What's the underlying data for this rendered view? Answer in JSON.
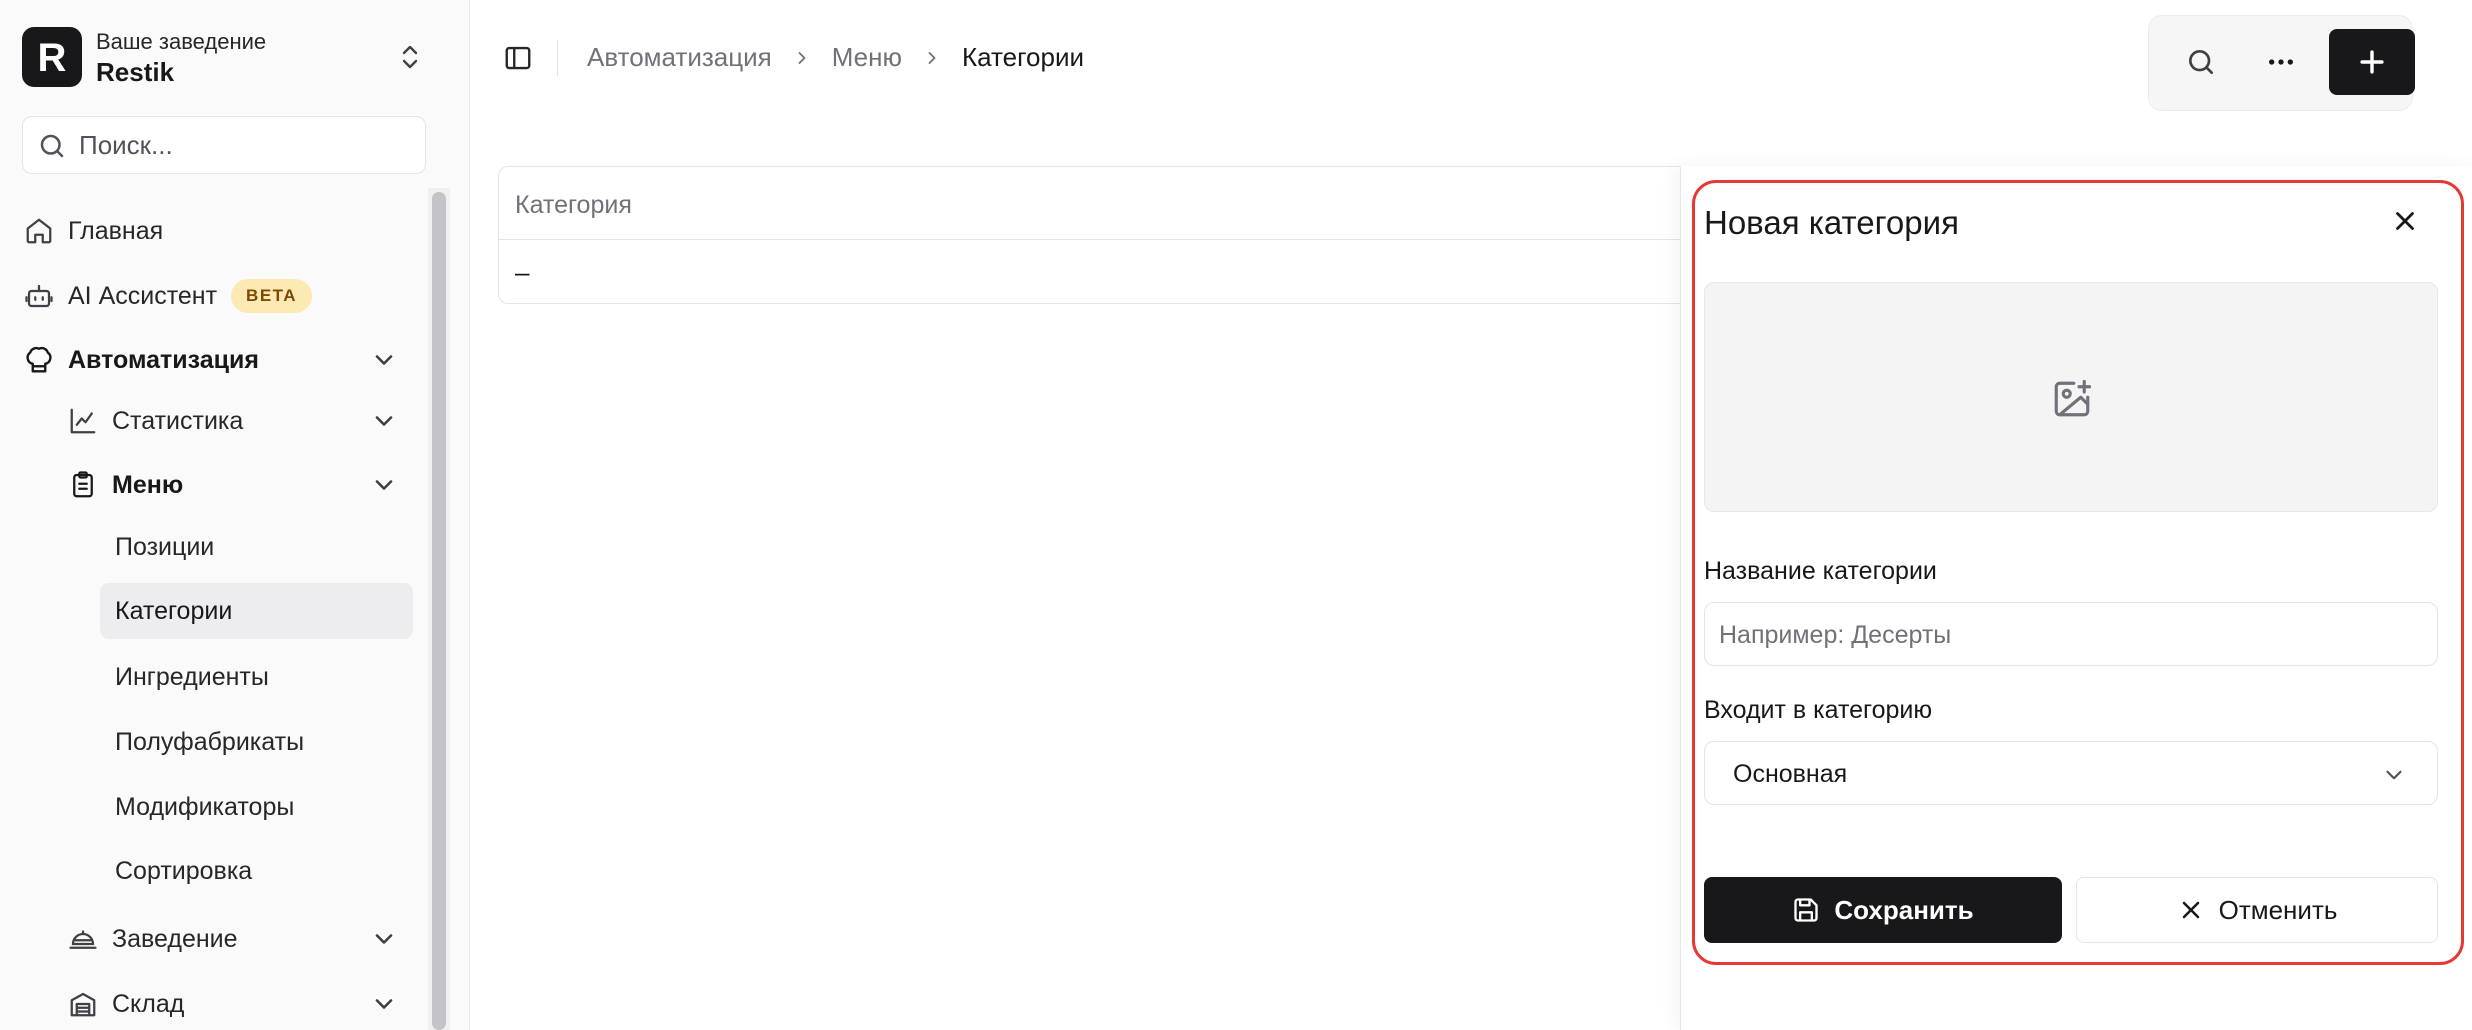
{
  "brand": {
    "subtitle": "Ваше заведение",
    "name": "Restik",
    "logo_letter": "R"
  },
  "sidebar": {
    "search_placeholder": "Поиск...",
    "home": "Главная",
    "ai": "AI Ассистент",
    "ai_badge": "BETA",
    "automation": "Автоматизация",
    "statistics": "Статистика",
    "menu": "Меню",
    "menu_items": [
      "Позиции",
      "Категории",
      "Ингредиенты",
      "Полуфабрикаты",
      "Модификаторы",
      "Сортировка"
    ],
    "venue": "Заведение",
    "warehouse": "Склад"
  },
  "breadcrumb": [
    "Автоматизация",
    "Меню",
    "Категории"
  ],
  "table": {
    "header": "Категория",
    "row": "–"
  },
  "drawer": {
    "title": "Новая категория",
    "name_label": "Название категории",
    "name_placeholder": "Например: Десерты",
    "parent_label": "Входит в категорию",
    "parent_value": "Основная",
    "save": "Сохранить",
    "cancel": "Отменить"
  },
  "colors": {
    "primary": "#18181b",
    "highlight": "#e53935",
    "beta_bg": "#fde9b4"
  }
}
